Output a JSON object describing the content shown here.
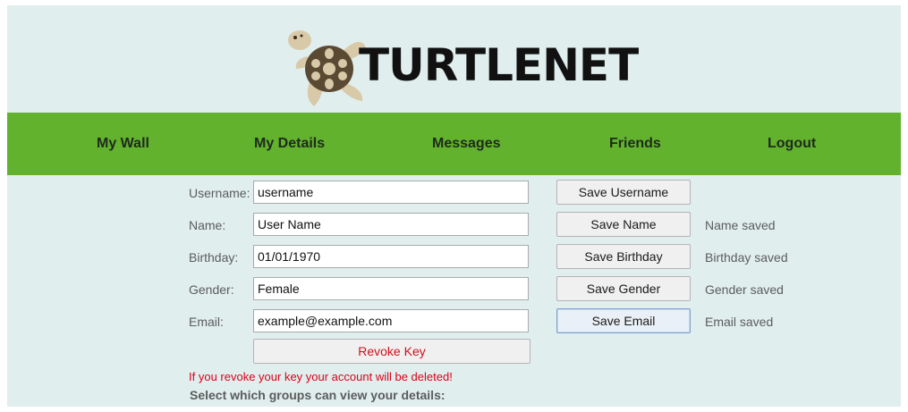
{
  "header": {
    "logo_text": "TURTLENET"
  },
  "nav": {
    "items": [
      "My Wall",
      "My Details",
      "Messages",
      "Friends",
      "Logout"
    ]
  },
  "form": {
    "rows": [
      {
        "label": "Username:",
        "value": "username",
        "button": "Save Username",
        "status": ""
      },
      {
        "label": "Name:",
        "value": "User Name",
        "button": "Save Name",
        "status": "Name saved"
      },
      {
        "label": "Birthday:",
        "value": "01/01/1970",
        "button": "Save Birthday",
        "status": "Birthday saved"
      },
      {
        "label": "Gender:",
        "value": "Female",
        "button": "Save Gender",
        "status": "Gender saved"
      },
      {
        "label": "Email:",
        "value": "example@example.com",
        "button": "Save Email",
        "status": "Email saved"
      }
    ],
    "revoke_label": "Revoke Key",
    "warning": "If you revoke your key your account will be deleted!",
    "groups_heading": "Select which groups can view your details:"
  },
  "colors": {
    "page_background": "#e0eeee",
    "nav_background": "#62b22d",
    "warning_text": "#e0001a",
    "turtle_shell": "#5b4a33",
    "turtle_skin": "#d8caa8"
  }
}
